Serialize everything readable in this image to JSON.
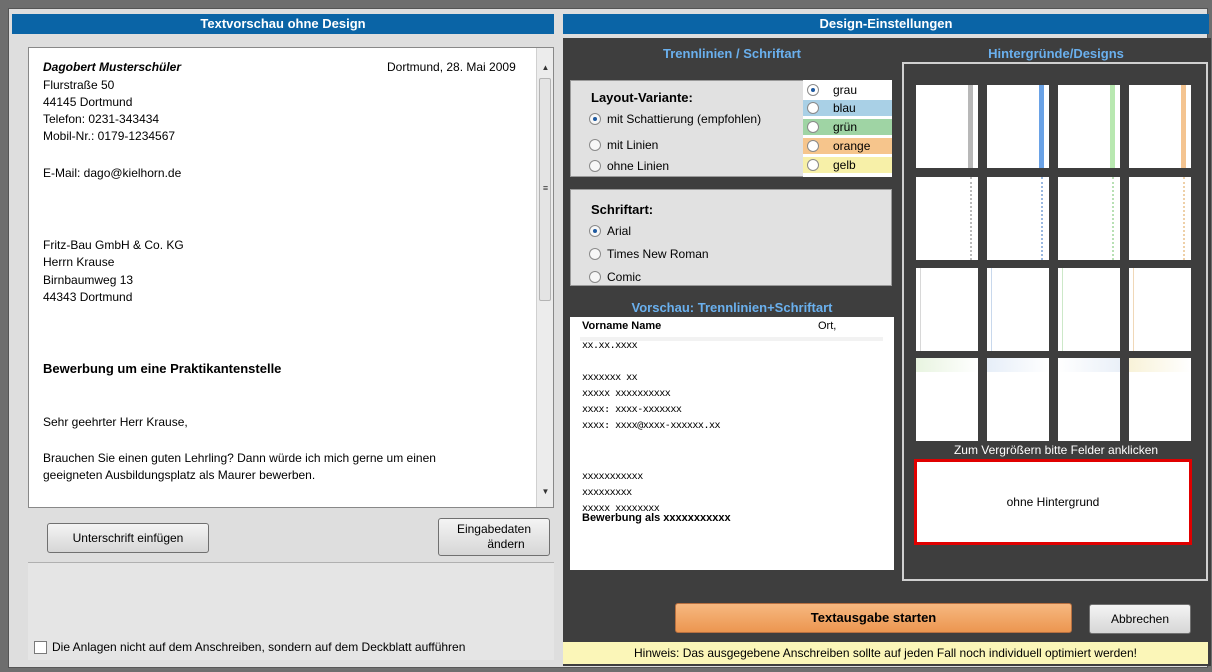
{
  "left": {
    "header": "Textvorschau ohne Design",
    "letter": {
      "sender_name": "Dagobert Musterschüler",
      "date": "Dortmund, 28. Mai 2009",
      "lines": [
        "Flurstraße 50",
        "44145 Dortmund",
        "Telefon: 0231-343434",
        "Mobil-Nr.: 0179-1234567"
      ],
      "email": "E-Mail: dago@kielhorn.de",
      "recipient": [
        "Fritz-Bau GmbH & Co. KG",
        "Herrn Krause",
        "Birnbaumweg 13",
        "44343 Dortmund"
      ],
      "subject": "Bewerbung um eine Praktikantenstelle",
      "salutation": "Sehr geehrter Herr Krause,",
      "body1": "Brauchen Sie einen guten Lehrling? Dann würde ich mich gerne um einen",
      "body2": "geeigneten Ausbildungsplatz als Maurer bewerben."
    },
    "btn_signature": "Unterschrift einfügen",
    "btn_change_1": "Eingabedaten",
    "btn_change_2": "ändern",
    "checkbox_label": "Die Anlagen nicht auf dem Anschreiben, sondern auf dem Deckblatt aufführen"
  },
  "right": {
    "header": "Design-Einstellungen",
    "lines_title": "Trennlinien / Schriftart",
    "backgrounds_title": "Hintergründe/Designs",
    "layout_label": "Layout-Variante:",
    "layout_options": [
      "mit Schattierung (empfohlen)",
      "mit Linien",
      "ohne Linien"
    ],
    "colors": [
      {
        "label": "grau",
        "color": "#ffffff"
      },
      {
        "label": "blau",
        "color": "#a9d0e6"
      },
      {
        "label": "grün",
        "color": "#9fd4a4"
      },
      {
        "label": "orange",
        "color": "#f6c58c"
      },
      {
        "label": "gelb",
        "color": "#f7f0a8"
      }
    ],
    "font_label": "Schriftart:",
    "font_options": [
      "Arial",
      "Times New Roman",
      "Comic"
    ],
    "preview_title": "Vorschau: Trennlinien+Schriftart",
    "preview": {
      "name": "Vorname Name",
      "ort": "Ort,",
      "lines": [
        "xx.xx.xxxx",
        "xxxxxxx xx",
        "xxxxx xxxxxxxxxx",
        "xxxx: xxxx-xxxxxxx",
        "xxxx: xxxx@xxxx-xxxxxx.xx",
        "xxxxxxxxxxx",
        "xxxxxxxxx",
        "xxxxx xxxxxxxx"
      ],
      "subject": "Bewerbung als xxxxxxxxxxx"
    },
    "enlarge_hint": "Zum Vergrößern bitte Felder anklicken",
    "no_background": "ohne Hintergrund",
    "btn_start": "Textausgabe starten",
    "btn_cancel": "Abbrechen",
    "hint": "Hinweis: Das ausgegebene Anschreiben sollte auf jeden Fall noch individuell optimiert werden!"
  },
  "colors": {
    "header_blue": "#0a64a6",
    "start_orange": "#f0a060",
    "selection_red": "#e00000",
    "hint_yellow": "#fbf6b8"
  }
}
